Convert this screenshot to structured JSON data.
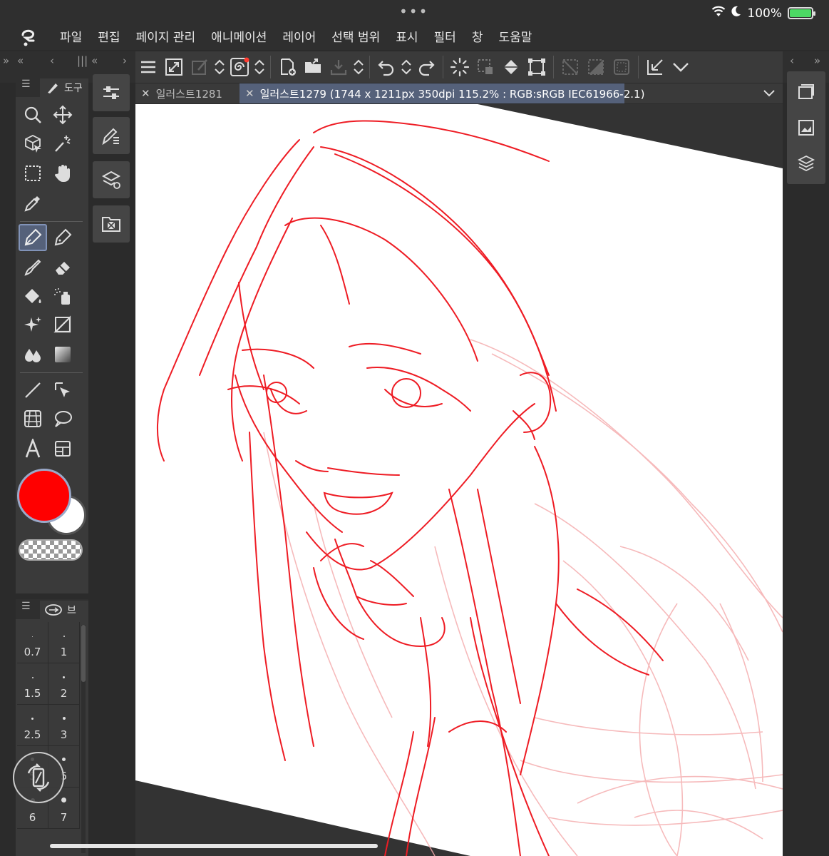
{
  "status_bar": {
    "battery_text": "100%",
    "battery_level": 1.0
  },
  "menu": {
    "items": [
      "파일",
      "편집",
      "페이지 관리",
      "애니메이션",
      "레이어",
      "선택 범위",
      "표시",
      "필터",
      "창",
      "도움말"
    ]
  },
  "tabs": [
    {
      "label": "일러스트1281",
      "active": false
    },
    {
      "label": "일러스트1279 (1744 x 1211px 350dpi 115.2% : RGB:sRGB IEC61966-2.1)",
      "active": true
    }
  ],
  "tool_panel": {
    "title": "도구"
  },
  "brush_panel": {
    "title": "브",
    "sizes": [
      "0.7",
      "1",
      "1.5",
      "2",
      "2.5",
      "3",
      "5",
      "5",
      "6",
      "7"
    ]
  },
  "colors": {
    "main": "#ff0000",
    "sub": "#ffffff",
    "accent": "#55617a"
  }
}
